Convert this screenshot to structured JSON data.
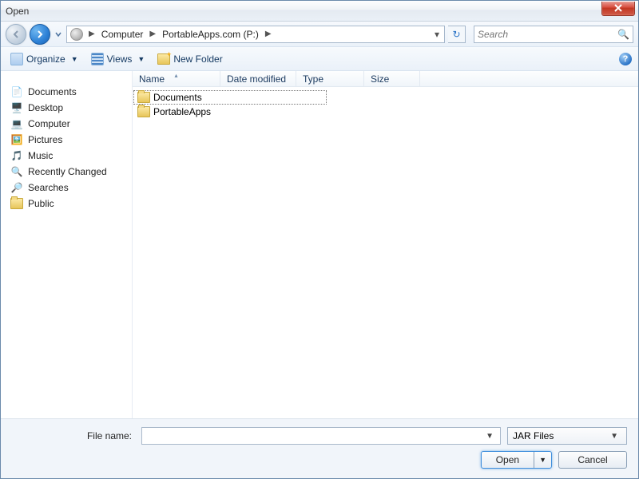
{
  "title": "Open",
  "breadcrumb": {
    "seg1": "Computer",
    "seg2": "PortableApps.com (P:)"
  },
  "search": {
    "placeholder": "Search"
  },
  "toolbar": {
    "organize": "Organize",
    "views": "Views",
    "newfolder": "New Folder"
  },
  "sidebar": {
    "items": [
      {
        "label": "Documents"
      },
      {
        "label": "Desktop"
      },
      {
        "label": "Computer"
      },
      {
        "label": "Pictures"
      },
      {
        "label": "Music"
      },
      {
        "label": "Recently Changed"
      },
      {
        "label": "Searches"
      },
      {
        "label": "Public"
      }
    ]
  },
  "columns": {
    "name": "Name",
    "date": "Date modified",
    "type": "Type",
    "size": "Size"
  },
  "files": [
    {
      "name": "Documents"
    },
    {
      "name": "PortableApps"
    }
  ],
  "filename_label": "File name:",
  "filename_value": "",
  "filter": "JAR Files",
  "buttons": {
    "open": "Open",
    "cancel": "Cancel"
  }
}
